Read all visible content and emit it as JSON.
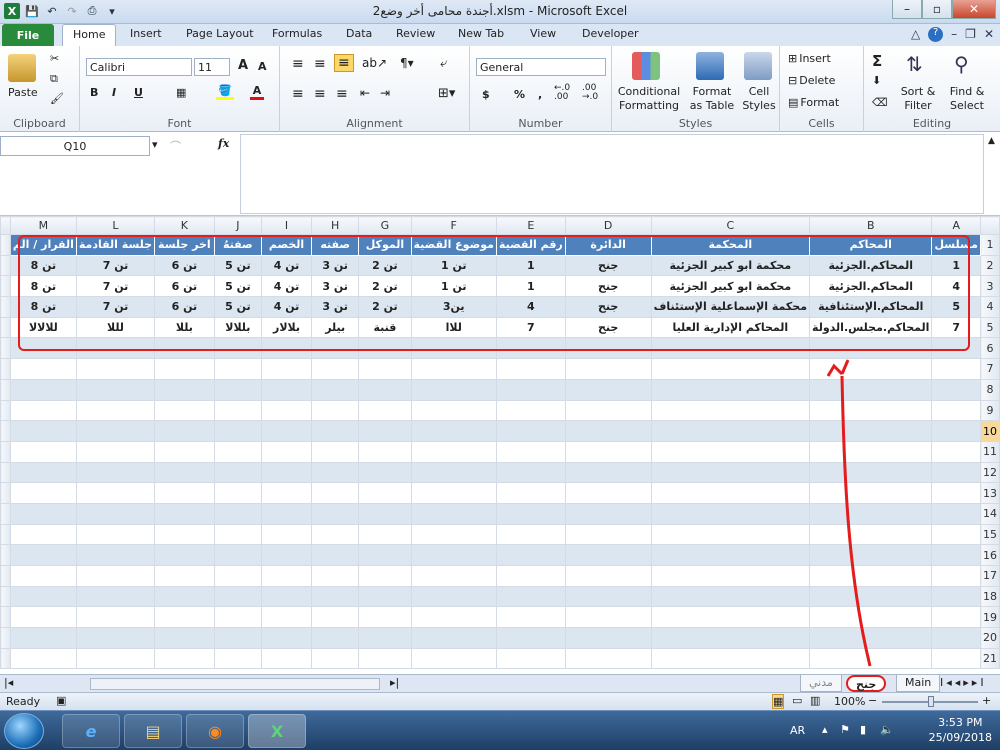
{
  "window": {
    "title": "أجندة محامى أخر وضع2.xlsm - Microsoft Excel",
    "controls": {
      "minimize": "–",
      "restore": "▫",
      "close": "✕"
    }
  },
  "ribbon_tabs": [
    "File",
    "Home",
    "Insert",
    "Page Layout",
    "Formulas",
    "Data",
    "Review",
    "New Tab",
    "View",
    "Developer"
  ],
  "ribbon": {
    "clipboard": {
      "label": "Clipboard",
      "paste": "Paste"
    },
    "font": {
      "label": "Font",
      "name": "Calibri",
      "size": "11",
      "bold": "B",
      "italic": "I",
      "underline": "U",
      "grow": "A",
      "shrink": "A",
      "font_color": "A"
    },
    "alignment": {
      "label": "Alignment"
    },
    "number": {
      "label": "Number",
      "format": "General",
      "currency": "$",
      "percent": "%",
      "comma": ",",
      "inc_dec": "←.0 .00",
      "dec_dec": ".00 →.0"
    },
    "styles": {
      "label": "Styles",
      "conditional": [
        "Conditional",
        "Formatting"
      ],
      "format_table": [
        "Format",
        "as Table"
      ],
      "cell_styles": [
        "Cell",
        "Styles"
      ]
    },
    "cells": {
      "label": "Cells",
      "insert": "Insert",
      "delete": "Delete",
      "format": "Format"
    },
    "editing": {
      "label": "Editing",
      "sigma": "Σ",
      "sort": [
        "Sort &",
        "Filter"
      ],
      "find": [
        "Find &",
        "Select"
      ]
    }
  },
  "formula_bar": {
    "name_box": "Q10",
    "fx": "fx",
    "formula": ""
  },
  "columns": [
    "A",
    "B",
    "C",
    "D",
    "E",
    "F",
    "G",
    "H",
    "I",
    "J",
    "K",
    "L",
    "M"
  ],
  "rows": [
    "1",
    "2",
    "3",
    "4",
    "5",
    "6",
    "7",
    "8",
    "9",
    "10",
    "11",
    "12",
    "13",
    "14",
    "15",
    "16",
    "17",
    "18",
    "19",
    "20",
    "21"
  ],
  "selected_row": "10",
  "table": {
    "headers": [
      "مسلسل",
      "المحاكم",
      "المحكمة",
      "الدائرة",
      "رقم القضية",
      "موضوع القضية",
      "الموكل",
      "صفته",
      "الخصم",
      "صفتهُ",
      "اخر جلسة",
      "جلسة القادمة",
      "القرار / الم"
    ],
    "rows": [
      [
        "1",
        "المحاكم.الجزئية",
        "محكمة ابو كبير الجزئية",
        "جنح",
        "1",
        "تن 1",
        "تن 2",
        "تن 3",
        "تن 4",
        "تن 5",
        "تن 6",
        "تن 7",
        "تن 8"
      ],
      [
        "4",
        "المحاكم.الجزئية",
        "محكمة ابو كبير الجزئية",
        "جنح",
        "1",
        "تن 1",
        "تن 2",
        "تن 3",
        "تن 4",
        "تن 5",
        "تن 6",
        "تن 7",
        "تن 8"
      ],
      [
        "5",
        "المحاكم.الإستئنافية",
        "محكمة الإسماعلية الإستئناف",
        "جنح",
        "4",
        "ين3",
        "تن 2",
        "تن 3",
        "تن 4",
        "تن 5",
        "تن 6",
        "تن 7",
        "تن 8"
      ],
      [
        "7",
        "المحاكم.مجلس.الدولة",
        "المحاكم الإدارية العليا",
        "جنح",
        "7",
        "للاا",
        "قنبة",
        "بيلر",
        "بلالار",
        "بللالا",
        "بللا",
        "لللا",
        "للالالا"
      ]
    ]
  },
  "sheet_tabs": [
    "Main",
    "جنح",
    "مدني"
  ],
  "active_sheet": "جنح",
  "status": {
    "ready": "Ready",
    "zoom": "100%",
    "minus": "−",
    "plus": "+"
  },
  "taskbar": {
    "lang": "AR",
    "time": "3:53 PM",
    "date": "25/09/2018",
    "apps": [
      "e",
      "▤",
      "◉",
      "X"
    ]
  }
}
